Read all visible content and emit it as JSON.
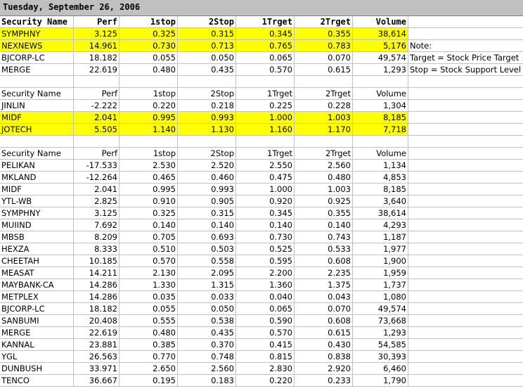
{
  "sheet": {
    "title": "Tuesday, September 26, 2006",
    "headers": [
      "Security Name",
      "Perf",
      "1stop",
      "2Stop",
      "1Trget",
      "2Trget",
      "Volume"
    ],
    "notes": [
      "",
      "Note:",
      "Target = Stock Price Target",
      "Stop = Stock Support Level"
    ],
    "section1": [
      {
        "name": "SYMPHNY",
        "perf": "3.125",
        "stop1": "0.325",
        "stop2": "0.315",
        "trg1": "0.345",
        "trg2": "0.355",
        "vol": "38,614",
        "hl": true
      },
      {
        "name": "NEXNEWS",
        "perf": "14.961",
        "stop1": "0.730",
        "stop2": "0.713",
        "trg1": "0.765",
        "trg2": "0.783",
        "vol": "5,176",
        "hl": true
      },
      {
        "name": "BJCORP-LC",
        "perf": "18.182",
        "stop1": "0.055",
        "stop2": "0.050",
        "trg1": "0.065",
        "trg2": "0.070",
        "vol": "49,574",
        "hl": false
      },
      {
        "name": "MERGE",
        "perf": "22.619",
        "stop1": "0.480",
        "stop2": "0.435",
        "trg1": "0.570",
        "trg2": "0.615",
        "vol": "1,293",
        "hl": false
      }
    ],
    "section2": [
      {
        "name": "JINLIN",
        "perf": "-2.222",
        "stop1": "0.220",
        "stop2": "0.218",
        "trg1": "0.225",
        "trg2": "0.228",
        "vol": "1,304",
        "hl": false
      },
      {
        "name": "MIDF",
        "perf": "2.041",
        "stop1": "0.995",
        "stop2": "0.993",
        "trg1": "1.000",
        "trg2": "1.003",
        "vol": "8,185",
        "hl": true
      },
      {
        "name": "JOTECH",
        "perf": "5.505",
        "stop1": "1.140",
        "stop2": "1.130",
        "trg1": "1.160",
        "trg2": "1.170",
        "vol": "7,718",
        "hl": true
      }
    ],
    "section3": [
      {
        "name": "PELIKAN",
        "perf": "-17.533",
        "stop1": "2.530",
        "stop2": "2.520",
        "trg1": "2.550",
        "trg2": "2.560",
        "vol": "1,134"
      },
      {
        "name": "MKLAND",
        "perf": "-12.264",
        "stop1": "0.465",
        "stop2": "0.460",
        "trg1": "0.475",
        "trg2": "0.480",
        "vol": "4,853"
      },
      {
        "name": "MIDF",
        "perf": "2.041",
        "stop1": "0.995",
        "stop2": "0.993",
        "trg1": "1.000",
        "trg2": "1.003",
        "vol": "8,185"
      },
      {
        "name": "YTL-WB",
        "perf": "2.825",
        "stop1": "0.910",
        "stop2": "0.905",
        "trg1": "0.920",
        "trg2": "0.925",
        "vol": "3,640"
      },
      {
        "name": "SYMPHNY",
        "perf": "3.125",
        "stop1": "0.325",
        "stop2": "0.315",
        "trg1": "0.345",
        "trg2": "0.355",
        "vol": "38,614"
      },
      {
        "name": "MUIIND",
        "perf": "7.692",
        "stop1": "0.140",
        "stop2": "0.140",
        "trg1": "0.140",
        "trg2": "0.140",
        "vol": "4,293"
      },
      {
        "name": "MBSB",
        "perf": "8.209",
        "stop1": "0.705",
        "stop2": "0.693",
        "trg1": "0.730",
        "trg2": "0.743",
        "vol": "1,187"
      },
      {
        "name": "HEXZA",
        "perf": "8.333",
        "stop1": "0.510",
        "stop2": "0.503",
        "trg1": "0.525",
        "trg2": "0.533",
        "vol": "1,977"
      },
      {
        "name": "CHEETAH",
        "perf": "10.185",
        "stop1": "0.570",
        "stop2": "0.558",
        "trg1": "0.595",
        "trg2": "0.608",
        "vol": "1,900"
      },
      {
        "name": "MEASAT",
        "perf": "14.211",
        "stop1": "2.130",
        "stop2": "2.095",
        "trg1": "2.200",
        "trg2": "2.235",
        "vol": "1,959"
      },
      {
        "name": "MAYBANK-CA",
        "perf": "14.286",
        "stop1": "1.330",
        "stop2": "1.315",
        "trg1": "1.360",
        "trg2": "1.375",
        "vol": "1,737"
      },
      {
        "name": "METPLEX",
        "perf": "14.286",
        "stop1": "0.035",
        "stop2": "0.033",
        "trg1": "0.040",
        "trg2": "0.043",
        "vol": "1,080"
      },
      {
        "name": "BJCORP-LC",
        "perf": "18.182",
        "stop1": "0.055",
        "stop2": "0.050",
        "trg1": "0.065",
        "trg2": "0.070",
        "vol": "49,574"
      },
      {
        "name": "SANBUMI",
        "perf": "20.408",
        "stop1": "0.555",
        "stop2": "0.538",
        "trg1": "0.590",
        "trg2": "0.608",
        "vol": "73,668"
      },
      {
        "name": "MERGE",
        "perf": "22.619",
        "stop1": "0.480",
        "stop2": "0.435",
        "trg1": "0.570",
        "trg2": "0.615",
        "vol": "1,293"
      },
      {
        "name": "KANNAL",
        "perf": "23.881",
        "stop1": "0.385",
        "stop2": "0.370",
        "trg1": "0.415",
        "trg2": "0.430",
        "vol": "54,585"
      },
      {
        "name": "YGL",
        "perf": "26.563",
        "stop1": "0.770",
        "stop2": "0.748",
        "trg1": "0.815",
        "trg2": "0.838",
        "vol": "30,393"
      },
      {
        "name": "DUNBUSH",
        "perf": "33.971",
        "stop1": "2.650",
        "stop2": "2.560",
        "trg1": "2.830",
        "trg2": "2.920",
        "vol": "6,460"
      },
      {
        "name": "TENCO",
        "perf": "36.667",
        "stop1": "0.195",
        "stop2": "0.183",
        "trg1": "0.220",
        "trg2": "0.233",
        "vol": "1,790"
      }
    ],
    "colors": {
      "highlight": "#ffff00",
      "title_bg": "#c0c0c0",
      "gridline": "#c0c0c0"
    }
  }
}
